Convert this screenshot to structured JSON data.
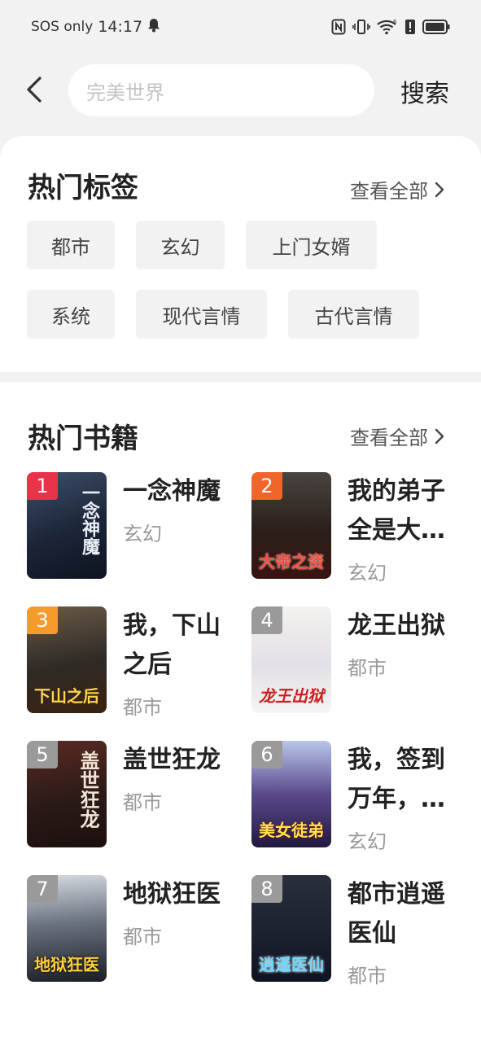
{
  "status": {
    "network": "SOS only",
    "time": "14:17"
  },
  "search": {
    "placeholder": "完美世界",
    "button_label": "搜索"
  },
  "hot_tags": {
    "title": "热门标签",
    "view_all": "查看全部",
    "tags": [
      "都市",
      "玄幻",
      "上门女婿",
      "系统",
      "现代言情",
      "古代言情"
    ]
  },
  "hot_books": {
    "title": "热门书籍",
    "view_all": "查看全部",
    "books": [
      {
        "rank": "1",
        "title": "一念神魔",
        "genre": "玄幻",
        "cover_text": "一念神魔"
      },
      {
        "rank": "2",
        "title": "我的弟子全是大…",
        "genre": "玄幻",
        "cover_text": "大帝之资"
      },
      {
        "rank": "3",
        "title": "我，下山之后",
        "genre": "都市",
        "cover_text": "下山之后"
      },
      {
        "rank": "4",
        "title": "龙王出狱",
        "genre": "都市",
        "cover_text": "龙王出狱"
      },
      {
        "rank": "5",
        "title": "盖世狂龙",
        "genre": "都市",
        "cover_text": "盖世狂龙"
      },
      {
        "rank": "6",
        "title": "我，签到万年，…",
        "genre": "玄幻",
        "cover_text": "美女徒弟"
      },
      {
        "rank": "7",
        "title": "地狱狂医",
        "genre": "都市",
        "cover_text": "地狱狂医"
      },
      {
        "rank": "8",
        "title": "都市逍遥医仙",
        "genre": "都市",
        "cover_text": "逍遥医仙"
      }
    ]
  },
  "colors": {
    "rank_1": "#e8334a",
    "rank_2": "#f0652b",
    "rank_3": "#f49b2c",
    "rank_other": "#9a9a9a"
  }
}
